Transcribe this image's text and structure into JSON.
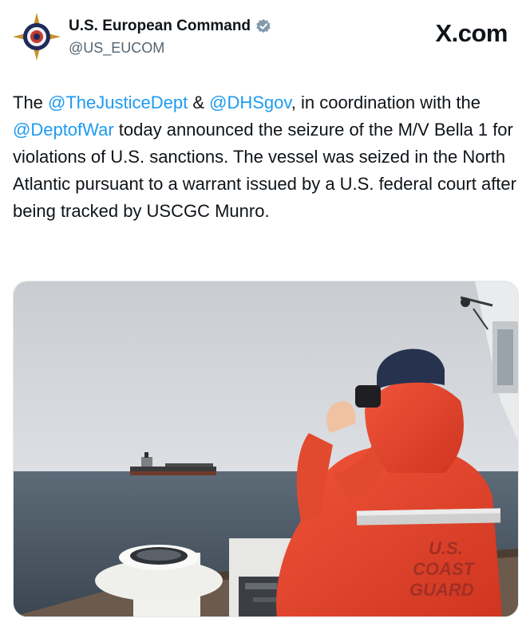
{
  "account": {
    "display_name": "U.S. European Command",
    "handle": "@US_EUCOM",
    "verified_icon": "verified-badge-icon"
  },
  "site": {
    "brand": "X.com"
  },
  "tweet": {
    "t1": "The ",
    "m1": "@TheJusticeDept",
    "t2": " & ",
    "m2": "@DHSgov",
    "t3": ", in coordination with the ",
    "m3": "@DeptofWar",
    "t4": " today announced the seizure of the M/V Bella 1 for violations of U.S. sanctions. The vessel was seized in the North Atlantic pursuant to a warrant issued by a U.S. federal court after being tracked by USCGC Munro."
  },
  "media": {
    "jacket_line1": "U.S.",
    "jacket_line2": "COAST",
    "jacket_line3": "GUARD"
  },
  "colors": {
    "mention": "#1d9bf0",
    "text": "#0f1419",
    "handle": "#536471",
    "jacket": "#e8432a",
    "sea": "#4a5866"
  }
}
